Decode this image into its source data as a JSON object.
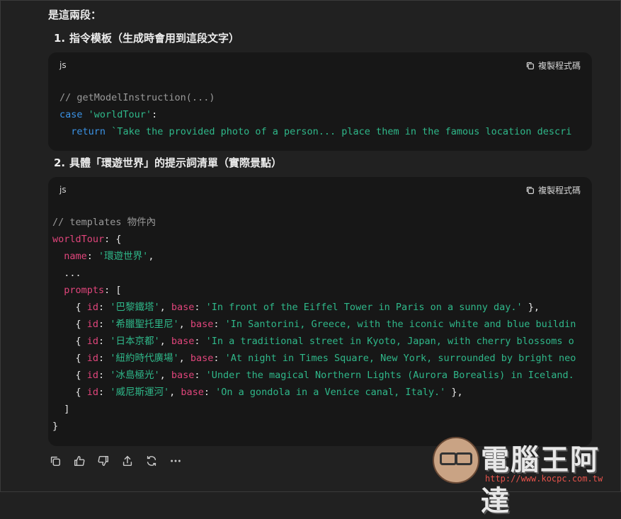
{
  "intro": "是這兩段：",
  "sections": [
    {
      "num": "1.",
      "title": "指令模板（生成時會用到這段文字）"
    },
    {
      "num": "2.",
      "title": "具體「環遊世界」的提示詞清單（實際景點）"
    }
  ],
  "code_blocks": [
    {
      "lang": "js",
      "copy_label": "複製程式碼"
    },
    {
      "lang": "js",
      "copy_label": "複製程式碼"
    }
  ],
  "code1": {
    "comment": "// getModelInstruction(...)",
    "case_kw": "case",
    "case_str": "'worldTour'",
    "colon": ":",
    "return_kw": "return",
    "return_str": "`Take the provided photo of a person... place them in the famous location descri"
  },
  "code2": {
    "comment": "// templates 物件內",
    "key": "worldTour",
    "brace_open": ": {",
    "name_key": "name",
    "name_val": "'環遊世界'",
    "dots": "...",
    "prompts_key": "prompts",
    "bracket_open": ": [",
    "items": [
      {
        "id": "'巴黎鐵塔'",
        "base": "'In front of the Eiffel Tower in Paris on a sunny day.'",
        "tail": " },"
      },
      {
        "id": "'希臘聖托里尼'",
        "base": "'In Santorini, Greece, with the iconic white and blue buildin",
        "tail": ""
      },
      {
        "id": "'日本京都'",
        "base": "'In a traditional street in Kyoto, Japan, with cherry blossoms o",
        "tail": ""
      },
      {
        "id": "'紐約時代廣場'",
        "base": "'At night in Times Square, New York, surrounded by bright neo",
        "tail": ""
      },
      {
        "id": "'冰島極光'",
        "base": "'Under the magical Northern Lights (Aurora Borealis) in Iceland.",
        "tail": ""
      },
      {
        "id": "'威尼斯運河'",
        "base": "'On a gondola in a Venice canal, Italy.'",
        "tail": " },"
      }
    ],
    "bracket_close": "]",
    "brace_close": "}"
  },
  "actions": [
    "copy-icon",
    "thumbs-up-icon",
    "thumbs-down-icon",
    "share-icon",
    "regenerate-icon",
    "more-icon"
  ],
  "watermark": {
    "title": "電腦王阿達",
    "url": "http://www.kocpc.com.tw"
  }
}
